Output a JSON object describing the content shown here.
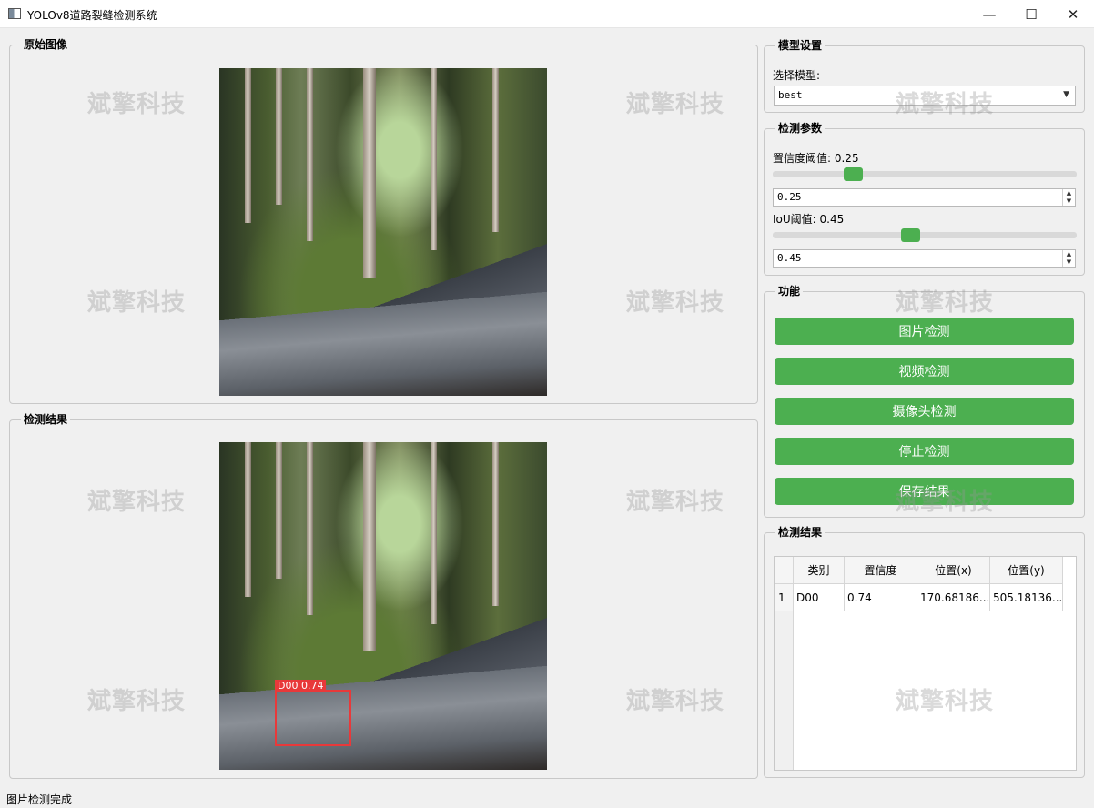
{
  "window": {
    "title": "YOLOv8道路裂缝检测系统",
    "min_glyph": "—",
    "max_glyph": "☐",
    "close_glyph": "✕"
  },
  "watermark_text": "斌擎科技",
  "original_group": {
    "title": "原始图像"
  },
  "result_image_group": {
    "title": "检测结果",
    "detection_label": "D00 0.74",
    "box_color": "#e8393a"
  },
  "model_settings": {
    "title": "模型设置",
    "select_label": "选择模型:",
    "selected_model": "best",
    "dropdown_arrow": "▼"
  },
  "detection_params": {
    "title": "检测参数",
    "confidence_label": "置信度阈值: 0.25",
    "confidence_value": "0.25",
    "confidence_level": 0.25,
    "iou_label": "IoU阈值: 0.45",
    "iou_value": "0.45",
    "iou_level": 0.45,
    "spin_up": "▲",
    "spin_down": "▼"
  },
  "functions": {
    "title": "功能",
    "buttons": [
      "图片检测",
      "视频检测",
      "摄像头检测",
      "停止检测",
      "保存结果"
    ],
    "accent_color": "#4caf50"
  },
  "results_table": {
    "title": "检测结果",
    "columns": [
      "类别",
      "置信度",
      "位置(x)",
      "位置(y)"
    ],
    "rows": [
      {
        "index": "1",
        "cells": [
          "D00",
          "0.74",
          "170.68186...",
          "505.18136..."
        ]
      }
    ]
  },
  "status": {
    "text": "图片检测完成"
  }
}
